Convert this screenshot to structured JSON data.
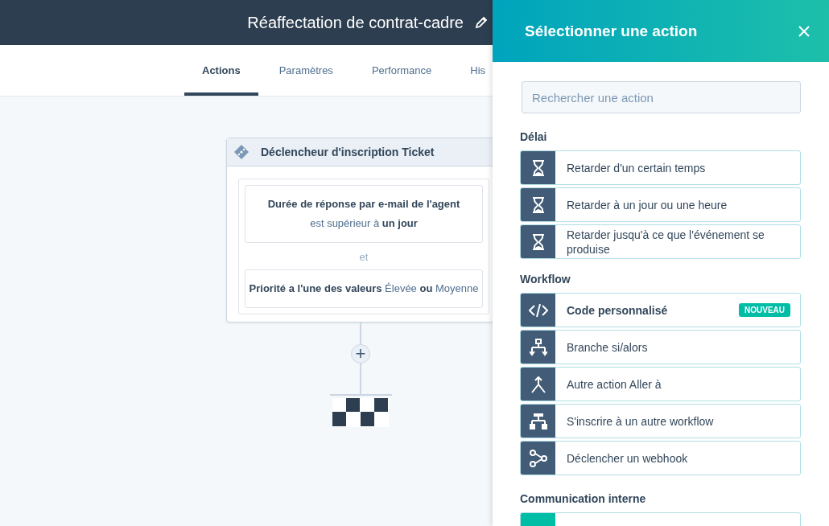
{
  "header": {
    "title": "Réaffectation de contrat-cadre"
  },
  "tabs": [
    {
      "label": "Actions",
      "selected": true
    },
    {
      "label": "Paramètres",
      "selected": false
    },
    {
      "label": "Performance",
      "selected": false
    },
    {
      "label": "His",
      "selected": false
    }
  ],
  "trigger": {
    "title": "Déclencheur d'inscription Ticket",
    "conditions": [
      {
        "property": "Durée de réponse par e-mail de l'agent",
        "text": "est supérieur à **un jour**"
      },
      {
        "text": "**Priorité a l'une des valeurs** Élevée **ou** Moyenne"
      }
    ],
    "joiner": "et"
  },
  "add_button": {
    "label": "+"
  },
  "panel": {
    "title": "Sélectionner une action",
    "search": {
      "placeholder": "Rechercher une action"
    },
    "sections": [
      {
        "title": "Délai",
        "items": [
          {
            "kind": "delay",
            "label": "Retarder d'un certain temps",
            "color": "#425b76"
          },
          {
            "kind": "delay",
            "label": "Retarder à un jour ou une heure",
            "color": "#425b76"
          },
          {
            "kind": "delay",
            "label": "Retarder jusqu'à ce que l'événement se produise",
            "color": "#425b76"
          }
        ]
      },
      {
        "title": "Workflow",
        "items": [
          {
            "kind": "code",
            "label": "Code personnalisé",
            "badge": "NOUVEAU",
            "color": "#425b76"
          },
          {
            "kind": "branch",
            "label": "Branche si/alors",
            "color": "#425b76"
          },
          {
            "kind": "goto",
            "label": "Autre action Aller à",
            "color": "#425b76"
          },
          {
            "kind": "enroll",
            "label": "S'inscrire à un autre workflow",
            "color": "#425b76"
          },
          {
            "kind": "webhook",
            "label": "Déclencher un webhook",
            "color": "#425b76"
          }
        ]
      },
      {
        "title": "Communication interne",
        "items": [
          {
            "kind": "other",
            "color": "#00bda5"
          }
        ]
      }
    ]
  }
}
